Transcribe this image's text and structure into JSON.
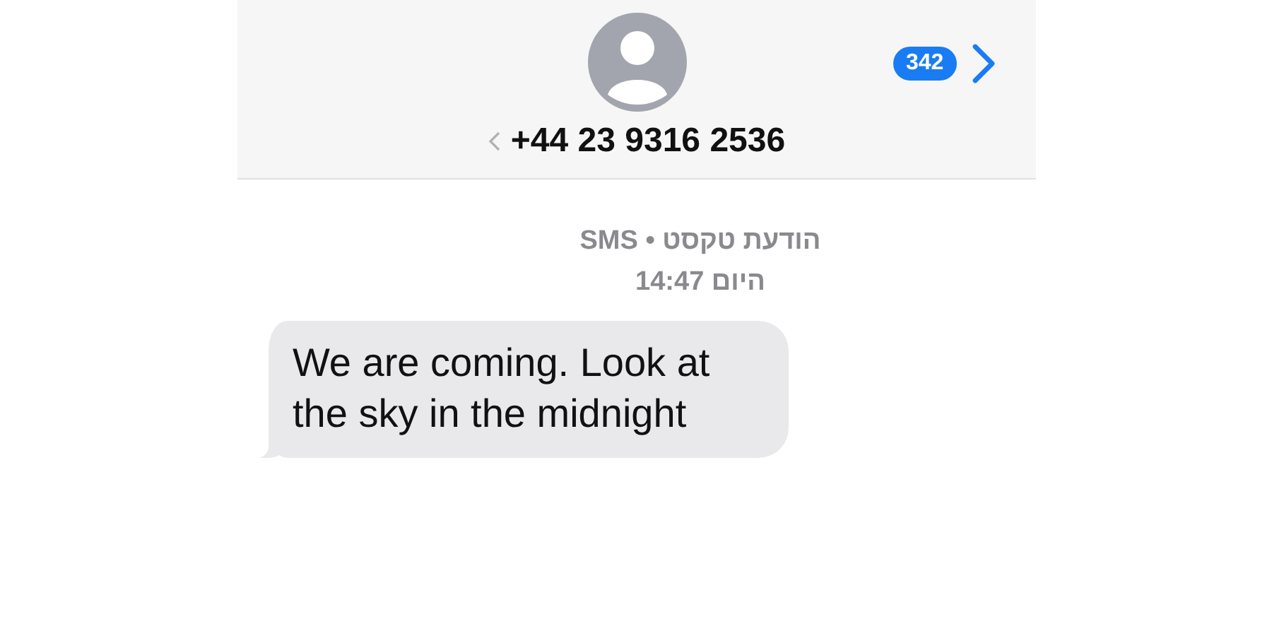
{
  "header": {
    "contact": "+44 23 9316 2536",
    "unread_count": "342"
  },
  "messages_meta": {
    "service": "הודעת טקסט • SMS",
    "time": "היום 14:47"
  },
  "messages": [
    {
      "kind": "received",
      "text": "We are coming. Look at the sky in the midnight"
    }
  ]
}
